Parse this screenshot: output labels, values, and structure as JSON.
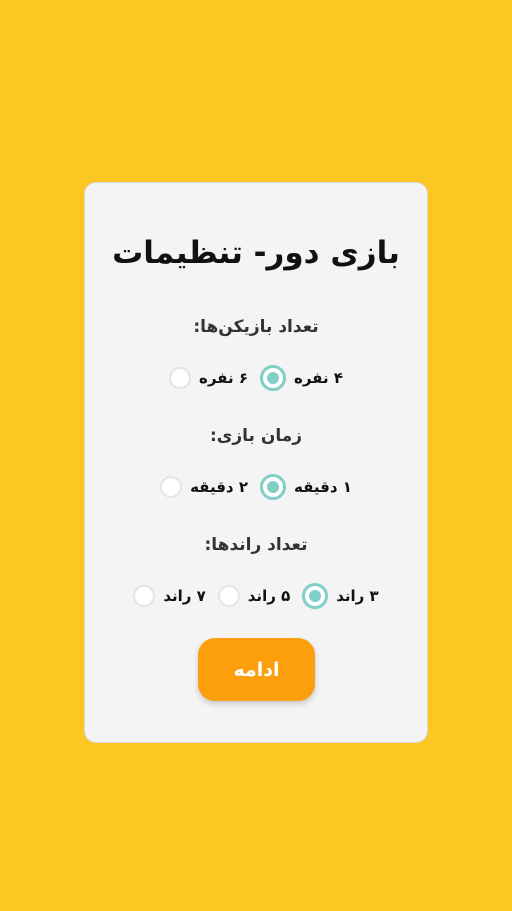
{
  "colors": {
    "background": "#FCC623",
    "card": "#F4F4F4",
    "accent_radio": "#7FCFC6",
    "button": "#FD9E0C"
  },
  "settings": {
    "title": "بازی دور- تنظیمات",
    "players": {
      "label": "تعداد بازیکن‌ها:",
      "options": [
        {
          "label": "۴ نفره",
          "selected": true
        },
        {
          "label": "۶ نفره",
          "selected": false
        }
      ]
    },
    "time": {
      "label": "زمان بازی:",
      "options": [
        {
          "label": "۱ دقیقه",
          "selected": true
        },
        {
          "label": "۲ دقیقه",
          "selected": false
        }
      ]
    },
    "rounds": {
      "label": "تعداد راندها:",
      "options": [
        {
          "label": "۳ راند",
          "selected": true
        },
        {
          "label": "۵ راند",
          "selected": false
        },
        {
          "label": "۷ راند",
          "selected": false
        }
      ]
    },
    "continue_label": "ادامه"
  }
}
